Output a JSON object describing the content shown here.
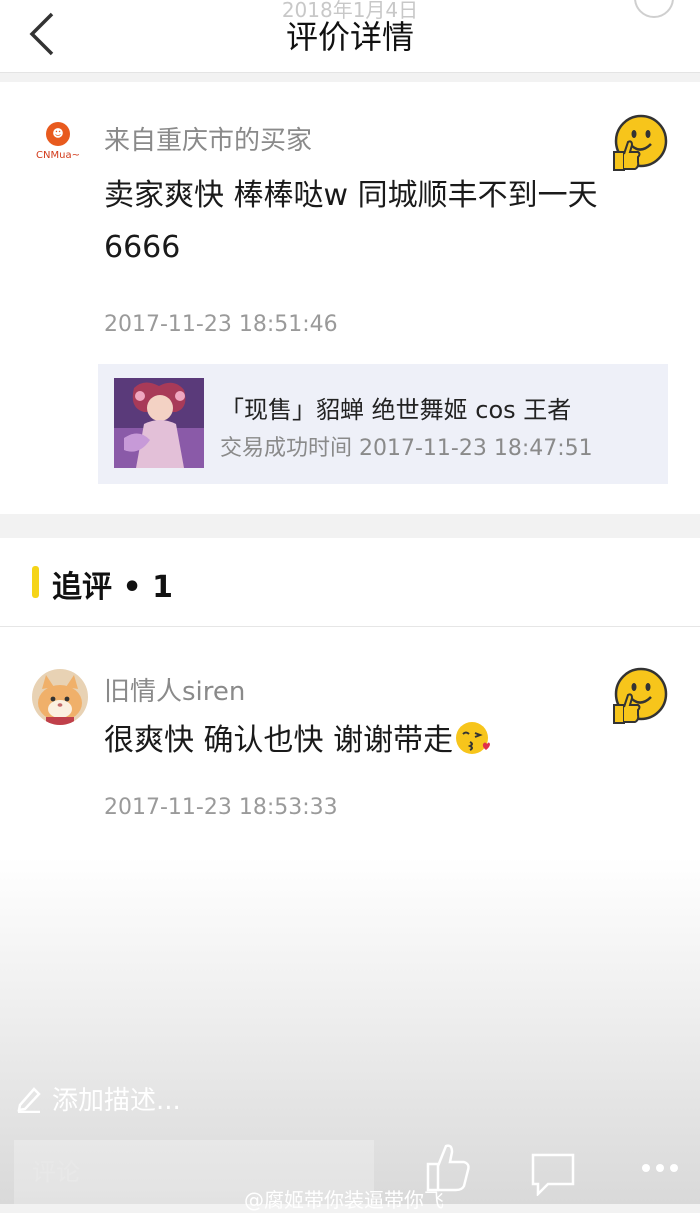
{
  "header": {
    "date": "2018年1月4日",
    "title": "评价详情"
  },
  "review": {
    "shop_logo_text": "CNMua~",
    "buyer": "来自重庆市的买家",
    "text": "卖家爽快 棒棒哒w 同城顺丰不到一天6666",
    "time": "2017-11-23 18:51:46",
    "product": {
      "name": "「现售」貂蝉 绝世舞姬 cos 王者",
      "deal_time": "交易成功时间 2017-11-23 18:47:51"
    }
  },
  "followup": {
    "label": "追评 • 1",
    "user": "旧情人siren",
    "text": "很爽快 确认也快 谢谢带走",
    "time": "2017-11-23 18:53:33"
  },
  "bottom": {
    "add_description": "添加描述...",
    "comment_placeholder": "评论",
    "watermark": "@腐姬带你装逼带你飞"
  },
  "icons": {
    "back": "back-arrow-icon",
    "like": "thumbs-up-emoji-icon",
    "kiss": "kiss-emoji-icon",
    "pen": "pen-icon",
    "thumb": "thumb-up-icon",
    "chat": "comment-bubble-icon",
    "more": "more-dots-icon"
  },
  "colors": {
    "accent_yellow": "#f5d418",
    "emoji_yellow": "#f7c51b",
    "product_bg": "#eef0f8"
  }
}
